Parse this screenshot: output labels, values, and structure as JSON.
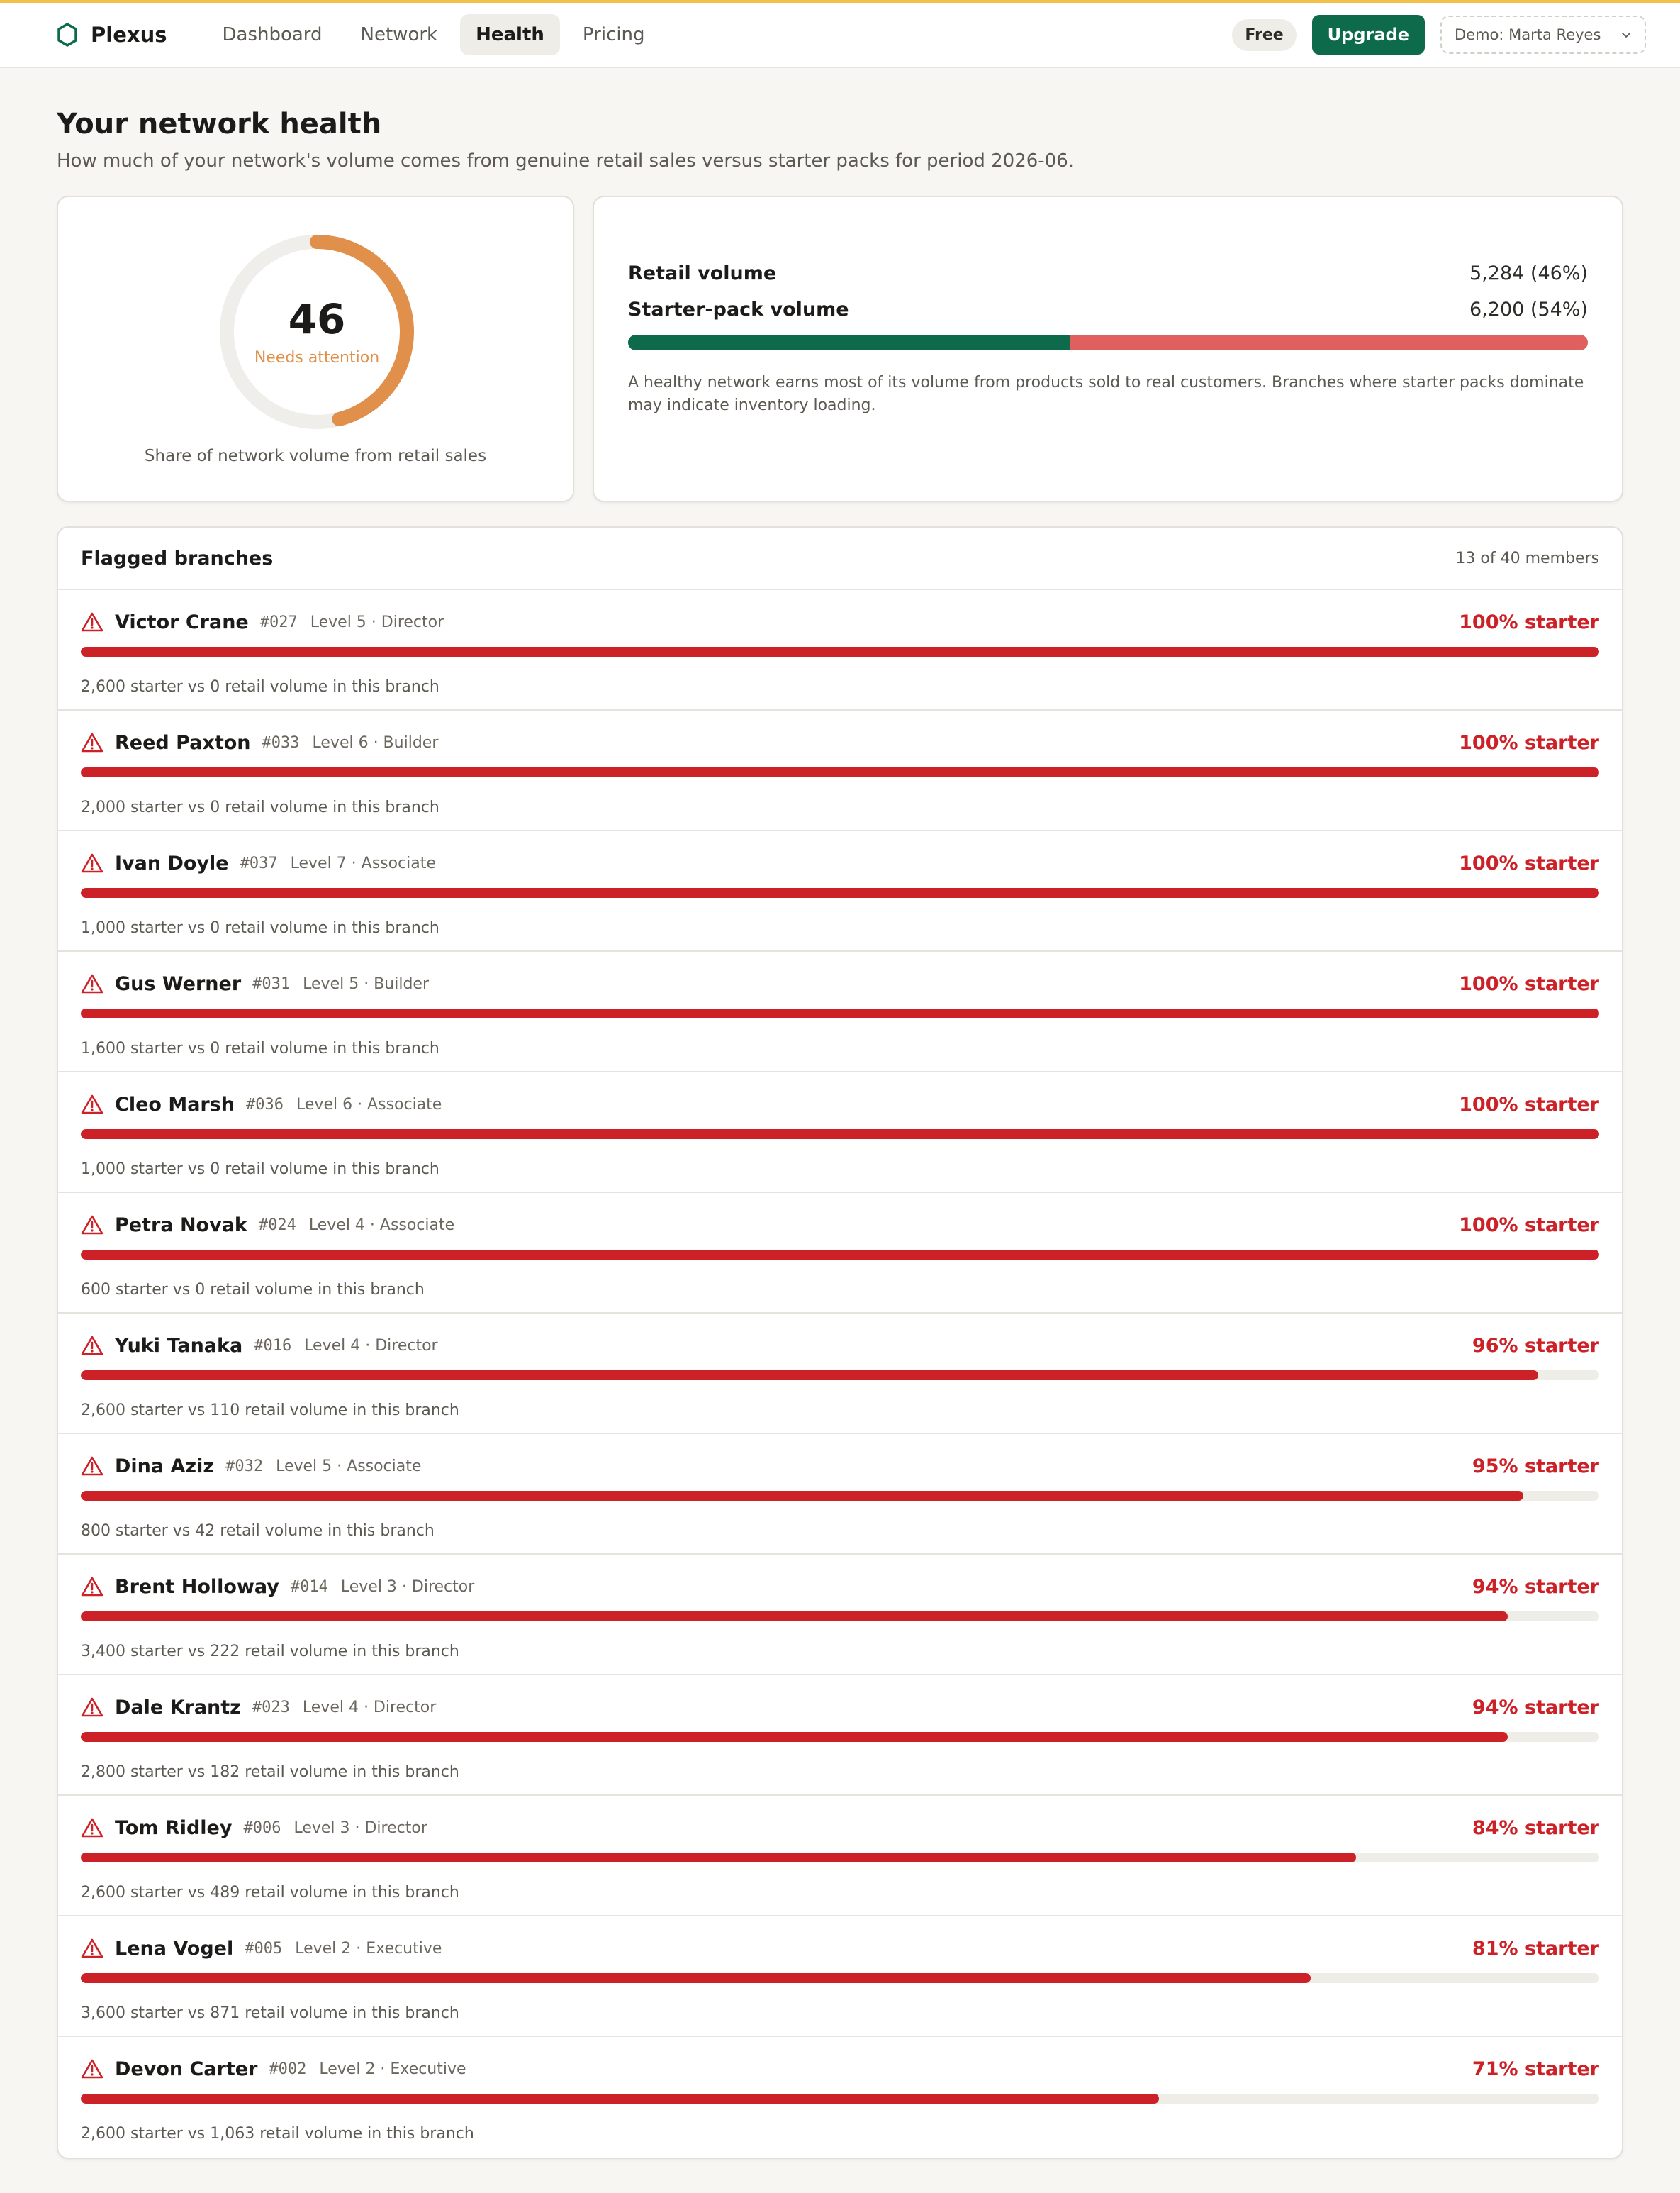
{
  "app": {
    "name": "Plexus",
    "accent": "#0d6b4c",
    "warning": "#cc2127",
    "gauge_color": "#e0904a"
  },
  "nav": {
    "links": [
      {
        "label": "Dashboard",
        "active": false
      },
      {
        "label": "Network",
        "active": false
      },
      {
        "label": "Health",
        "active": true
      },
      {
        "label": "Pricing",
        "active": false
      }
    ],
    "plan_badge": "Free",
    "upgrade_label": "Upgrade",
    "account_select": "Demo: Marta Reyes"
  },
  "page": {
    "title": "Your network health",
    "subtitle": "How much of your network's volume comes from genuine retail sales versus starter packs for period 2026-06."
  },
  "score": {
    "value": "46",
    "fraction": 0.46,
    "status": "Needs attention",
    "caption": "Share of network volume from retail sales"
  },
  "volume": {
    "retail_label": "Retail volume",
    "retail_value": "5,284 (46%)",
    "retail_fraction": 0.46,
    "starter_label": "Starter-pack volume",
    "starter_value": "6,200 (54%)",
    "note": "A healthy network earns most of its volume from products sold to real customers. Branches where starter packs dominate may indicate inventory loading."
  },
  "flagged": {
    "title": "Flagged branches",
    "count": "13 of 40 members",
    "branches": [
      {
        "name": "Victor Crane",
        "id": "#027",
        "level": "Level 5 · Director",
        "pct_label": "100% starter",
        "pct": 100,
        "note": "2,600 starter vs 0 retail volume in this branch"
      },
      {
        "name": "Reed Paxton",
        "id": "#033",
        "level": "Level 6 · Builder",
        "pct_label": "100% starter",
        "pct": 100,
        "note": "2,000 starter vs 0 retail volume in this branch"
      },
      {
        "name": "Ivan Doyle",
        "id": "#037",
        "level": "Level 7 · Associate",
        "pct_label": "100% starter",
        "pct": 100,
        "note": "1,000 starter vs 0 retail volume in this branch"
      },
      {
        "name": "Gus Werner",
        "id": "#031",
        "level": "Level 5 · Builder",
        "pct_label": "100% starter",
        "pct": 100,
        "note": "1,600 starter vs 0 retail volume in this branch"
      },
      {
        "name": "Cleo Marsh",
        "id": "#036",
        "level": "Level 6 · Associate",
        "pct_label": "100% starter",
        "pct": 100,
        "note": "1,000 starter vs 0 retail volume in this branch"
      },
      {
        "name": "Petra Novak",
        "id": "#024",
        "level": "Level 4 · Associate",
        "pct_label": "100% starter",
        "pct": 100,
        "note": "600 starter vs 0 retail volume in this branch"
      },
      {
        "name": "Yuki Tanaka",
        "id": "#016",
        "level": "Level 4 · Director",
        "pct_label": "96% starter",
        "pct": 96,
        "note": "2,600 starter vs 110 retail volume in this branch"
      },
      {
        "name": "Dina Aziz",
        "id": "#032",
        "level": "Level 5 · Associate",
        "pct_label": "95% starter",
        "pct": 95,
        "note": "800 starter vs 42 retail volume in this branch"
      },
      {
        "name": "Brent Holloway",
        "id": "#014",
        "level": "Level 3 · Director",
        "pct_label": "94% starter",
        "pct": 94,
        "note": "3,400 starter vs 222 retail volume in this branch"
      },
      {
        "name": "Dale Krantz",
        "id": "#023",
        "level": "Level 4 · Director",
        "pct_label": "94% starter",
        "pct": 94,
        "note": "2,800 starter vs 182 retail volume in this branch"
      },
      {
        "name": "Tom Ridley",
        "id": "#006",
        "level": "Level 3 · Director",
        "pct_label": "84% starter",
        "pct": 84,
        "note": "2,600 starter vs 489 retail volume in this branch"
      },
      {
        "name": "Lena Vogel",
        "id": "#005",
        "level": "Level 2 · Executive",
        "pct_label": "81% starter",
        "pct": 81,
        "note": "3,600 starter vs 871 retail volume in this branch"
      },
      {
        "name": "Devon Carter",
        "id": "#002",
        "level": "Level 2 · Executive",
        "pct_label": "71% starter",
        "pct": 71,
        "note": "2,600 starter vs 1,063 retail volume in this branch"
      }
    ]
  }
}
